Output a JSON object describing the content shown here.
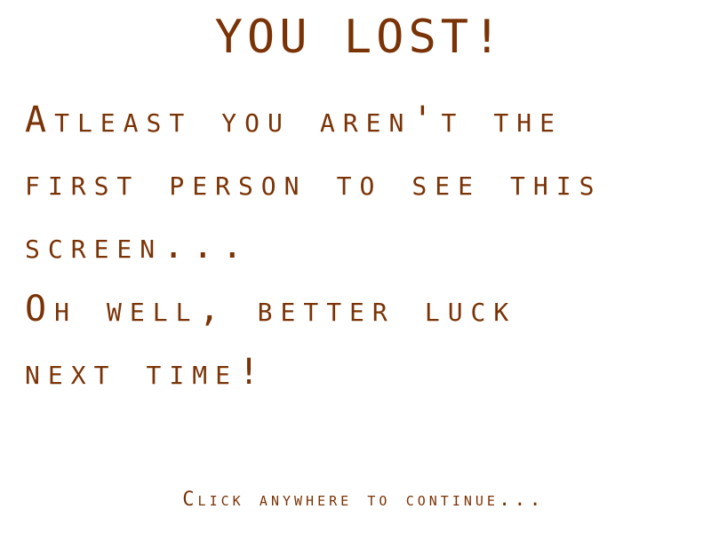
{
  "screen": {
    "title": "YOU LOST!",
    "message_lines": [
      "Atleast you aren't the",
      "first person to see this",
      "screen...",
      "Oh well, better luck",
      "next time!"
    ],
    "prompt": "Click anywhere to continue..."
  },
  "colors": {
    "text": "#7a3306",
    "background": "#ffffff"
  }
}
